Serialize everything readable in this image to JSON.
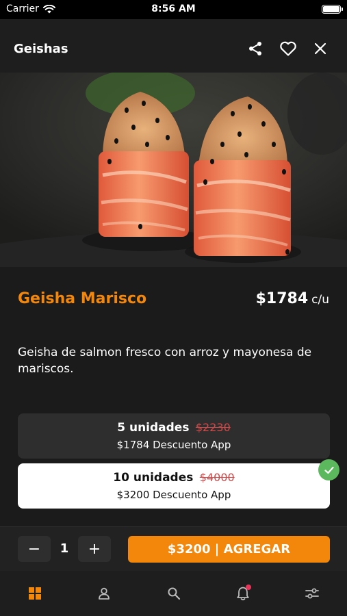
{
  "status_bar": {
    "carrier": "Carrier",
    "time": "8:56 AM"
  },
  "header": {
    "title": "Geishas",
    "icons": [
      "share-icon",
      "heart-icon",
      "close-icon"
    ]
  },
  "product": {
    "name": "Geisha Marisco",
    "price": "$1784",
    "price_unit": "c/u",
    "description": "Geisha de salmon fresco con arroz y mayonesa de mariscos."
  },
  "options": [
    {
      "units": "5 unidades",
      "old_price": "$2230",
      "app_price": "$1784 Descuento App",
      "selected": false
    },
    {
      "units": "10 unidades",
      "old_price": "$4000",
      "app_price": "$3200 Descuento App",
      "selected": true
    }
  ],
  "quantity": {
    "minus": "−",
    "value": "1",
    "plus": "+"
  },
  "add_button": {
    "label": "$3200 | AGREGAR"
  },
  "tab_bar": {
    "items": [
      "grid-icon",
      "user-icon",
      "search-icon",
      "bell-icon",
      "filter-icon"
    ],
    "active_color": "#f2870c"
  },
  "colors": {
    "accent": "#f2870c",
    "background": "#1b1b1b",
    "check": "#5cb85c"
  }
}
